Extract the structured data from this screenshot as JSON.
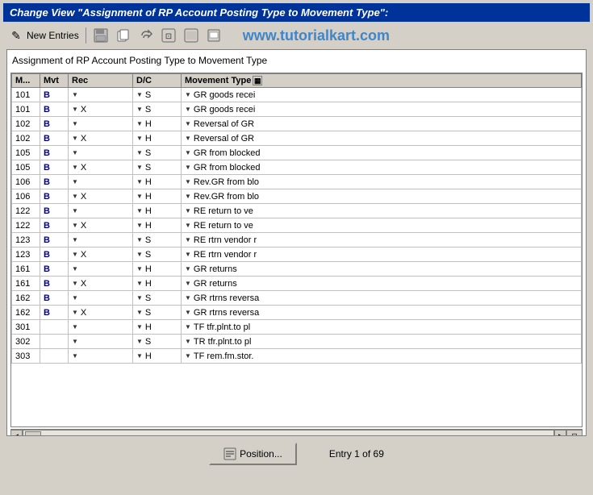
{
  "title": "Change View \"Assignment of RP Account Posting Type to Movement Type\":",
  "toolbar": {
    "new_entries_label": "New Entries",
    "watermark": "www.tutorialkart.com",
    "icons": [
      {
        "name": "edit-icon",
        "symbol": "✎"
      },
      {
        "name": "save-icon",
        "symbol": "💾"
      },
      {
        "name": "copy-icon",
        "symbol": "📋"
      },
      {
        "name": "undo-icon",
        "symbol": "↩"
      },
      {
        "name": "refresh-icon",
        "symbol": "🔄"
      },
      {
        "name": "info-icon",
        "symbol": "ℹ"
      },
      {
        "name": "print-icon",
        "symbol": "🖨"
      }
    ]
  },
  "panel": {
    "title": "Assignment of RP Account Posting Type to Movement Type"
  },
  "table": {
    "columns": [
      {
        "id": "m",
        "label": "M..."
      },
      {
        "id": "mvt",
        "label": "Mvt"
      },
      {
        "id": "rec",
        "label": "Rec"
      },
      {
        "id": "dc",
        "label": "D/C"
      },
      {
        "id": "movtype",
        "label": "Movement Type"
      }
    ],
    "rows": [
      {
        "m": "101",
        "mvt": "B",
        "rec": "",
        "dc": "S",
        "movtype": "GR goods recei"
      },
      {
        "m": "101",
        "mvt": "B",
        "rec": "X",
        "dc": "S",
        "movtype": "GR goods recei"
      },
      {
        "m": "102",
        "mvt": "B",
        "rec": "",
        "dc": "H",
        "movtype": "Reversal of GR"
      },
      {
        "m": "102",
        "mvt": "B",
        "rec": "X",
        "dc": "H",
        "movtype": "Reversal of GR"
      },
      {
        "m": "105",
        "mvt": "B",
        "rec": "",
        "dc": "S",
        "movtype": "GR from blocked"
      },
      {
        "m": "105",
        "mvt": "B",
        "rec": "X",
        "dc": "S",
        "movtype": "GR from blocked"
      },
      {
        "m": "106",
        "mvt": "B",
        "rec": "",
        "dc": "H",
        "movtype": "Rev.GR from blo"
      },
      {
        "m": "106",
        "mvt": "B",
        "rec": "X",
        "dc": "H",
        "movtype": "Rev.GR from blo"
      },
      {
        "m": "122",
        "mvt": "B",
        "rec": "",
        "dc": "H",
        "movtype": "RE return to ve"
      },
      {
        "m": "122",
        "mvt": "B",
        "rec": "X",
        "dc": "H",
        "movtype": "RE return to ve"
      },
      {
        "m": "123",
        "mvt": "B",
        "rec": "",
        "dc": "S",
        "movtype": "RE rtrn vendor r"
      },
      {
        "m": "123",
        "mvt": "B",
        "rec": "X",
        "dc": "S",
        "movtype": "RE rtrn vendor r"
      },
      {
        "m": "161",
        "mvt": "B",
        "rec": "",
        "dc": "H",
        "movtype": "GR returns"
      },
      {
        "m": "161",
        "mvt": "B",
        "rec": "X",
        "dc": "H",
        "movtype": "GR returns"
      },
      {
        "m": "162",
        "mvt": "B",
        "rec": "",
        "dc": "S",
        "movtype": "GR rtrns reversa"
      },
      {
        "m": "162",
        "mvt": "B",
        "rec": "X",
        "dc": "S",
        "movtype": "GR rtrns reversa"
      },
      {
        "m": "301",
        "mvt": "",
        "rec": "",
        "dc": "H",
        "movtype": "TF tfr.plnt.to pl"
      },
      {
        "m": "302",
        "mvt": "",
        "rec": "",
        "dc": "S",
        "movtype": "TR tfr.plnt.to pl"
      },
      {
        "m": "303",
        "mvt": "",
        "rec": "",
        "dc": "H",
        "movtype": "TF rem.fm.stor."
      }
    ]
  },
  "footer": {
    "position_button_label": "Position...",
    "entry_info": "Entry 1 of 69"
  }
}
